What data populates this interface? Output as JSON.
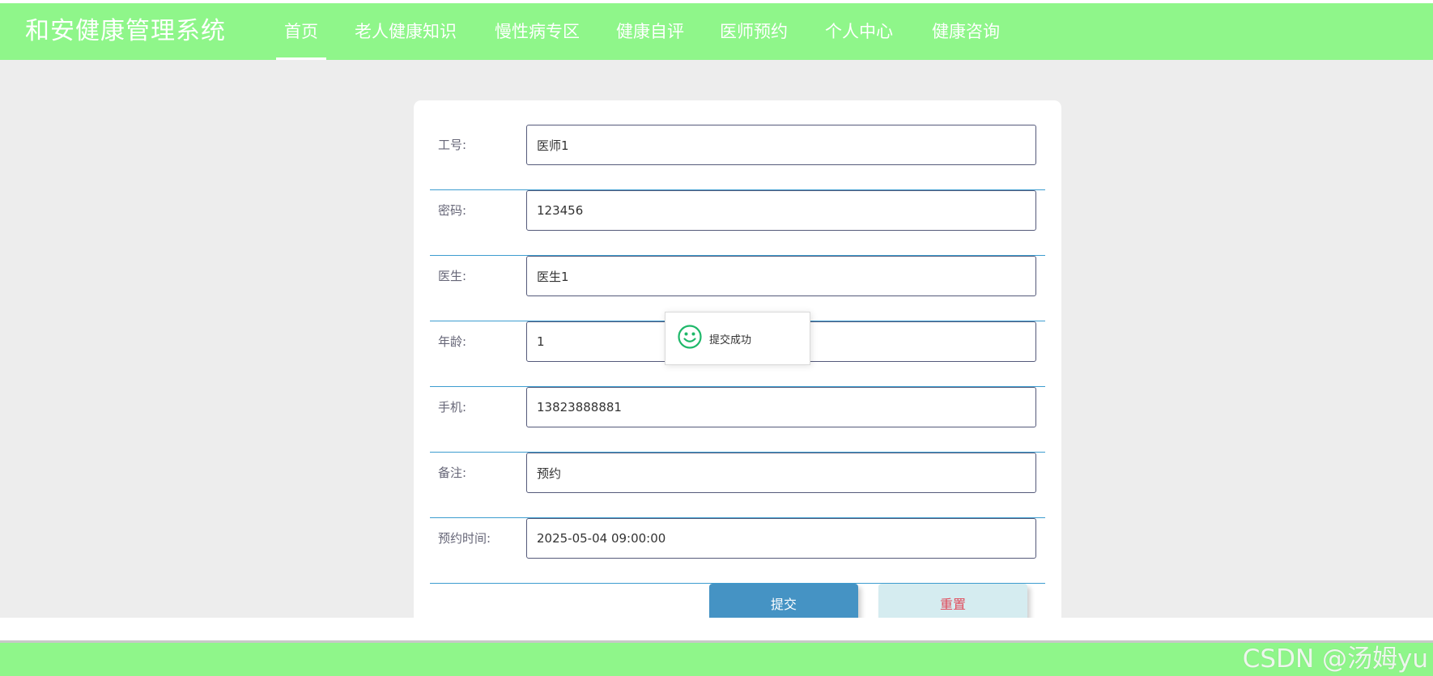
{
  "header": {
    "brand": "和安健康管理系统",
    "nav": [
      {
        "label": "首页",
        "active": true
      },
      {
        "label": "老人健康知识",
        "active": false
      },
      {
        "label": "慢性病专区",
        "active": false
      },
      {
        "label": "健康自评",
        "active": false
      },
      {
        "label": "医师预约",
        "active": false
      },
      {
        "label": "个人中心",
        "active": false
      },
      {
        "label": "健康咨询",
        "active": false
      }
    ]
  },
  "form": {
    "fields": [
      {
        "label": "工号:",
        "value": "医师1"
      },
      {
        "label": "密码:",
        "value": "123456"
      },
      {
        "label": "医生:",
        "value": "医生1"
      },
      {
        "label": "年龄:",
        "value": "1"
      },
      {
        "label": "手机:",
        "value": "13823888881"
      },
      {
        "label": "备注:",
        "value": "预约"
      },
      {
        "label": "预约时间:",
        "value": "2025-05-04 09:00:00"
      }
    ],
    "submit_label": "提交",
    "reset_label": "重置"
  },
  "toast": {
    "icon": "smile-icon",
    "message": "提交成功"
  },
  "watermark": "CSDN @汤姆yu",
  "colors": {
    "nav_bg": "#8ff68a",
    "content_bg": "#ededed",
    "submit_bg": "#4593c4",
    "reset_bg": "#d5ecf0",
    "reset_text": "#e04c5c",
    "success_icon": "#1fb86a"
  }
}
